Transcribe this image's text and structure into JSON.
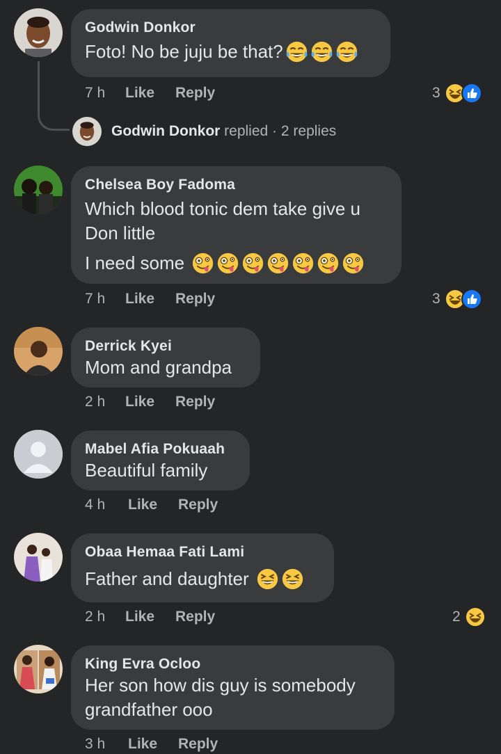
{
  "comments": [
    {
      "author": "Godwin Donkor",
      "lines": [
        "Foto! No be juju be that?"
      ],
      "time": "7 h",
      "like": "Like",
      "reply": "Reply",
      "reactions_count": "3",
      "avatar_icon": "boy-portrait-avatar",
      "emojis": [
        "tears-of-joy",
        "tears-of-joy",
        "tears-of-joy"
      ],
      "reaction_icons": [
        "haha",
        "like"
      ]
    },
    {
      "author": "Chelsea Boy Fadoma",
      "lines": [
        "Which blood tonic dem take give u",
        "Don little",
        "I need some"
      ],
      "time": "7 h",
      "like": "Like",
      "reply": "Reply",
      "reactions_count": "3",
      "avatar_icon": "two-men-avatar",
      "emojis": [
        "zany-face",
        "zany-face",
        "zany-face",
        "zany-face",
        "zany-face",
        "zany-face",
        "zany-face"
      ],
      "reaction_icons": [
        "haha",
        "like"
      ]
    },
    {
      "author": "Derrick Kyei",
      "lines": [
        "Mom and grandpa"
      ],
      "time": "2 h",
      "like": "Like",
      "reply": "Reply",
      "avatar_icon": "man-portrait-avatar"
    },
    {
      "author": "Mabel Afia Pokuaah",
      "lines": [
        "Beautiful family"
      ],
      "time": "4 h",
      "like": "Like",
      "reply": "Reply",
      "avatar_icon": "default-person-avatar"
    },
    {
      "author": "Obaa Hemaa Fati Lami",
      "lines": [
        "Father and daughter"
      ],
      "time": "2 h",
      "like": "Like",
      "reply": "Reply",
      "reactions_count": "2",
      "avatar_icon": "couple-avatar",
      "emojis": [
        "grinning-squinting-face",
        "grinning-squinting-face"
      ],
      "reaction_icons": [
        "haha"
      ]
    },
    {
      "author": "King Evra Ocloo",
      "lines": [
        "Her son how dis guy is somebody",
        "grandfather ooo"
      ],
      "time": "3 h",
      "like": "Like",
      "reply": "Reply",
      "avatar_icon": "family-photo-avatar"
    }
  ],
  "replies_row": {
    "name": "Godwin Donkor",
    "action": " replied",
    "separator": " · ",
    "count": "2 replies",
    "avatar_icon": "boy-portrait-avatar"
  },
  "colors": {
    "background": "#242526",
    "bubble": "#3a3b3c",
    "primary_text": "#e4e6eb",
    "secondary_text": "#b0b3b8",
    "like_blue": "#1877f2",
    "haha_yellow": "#f7c844"
  }
}
